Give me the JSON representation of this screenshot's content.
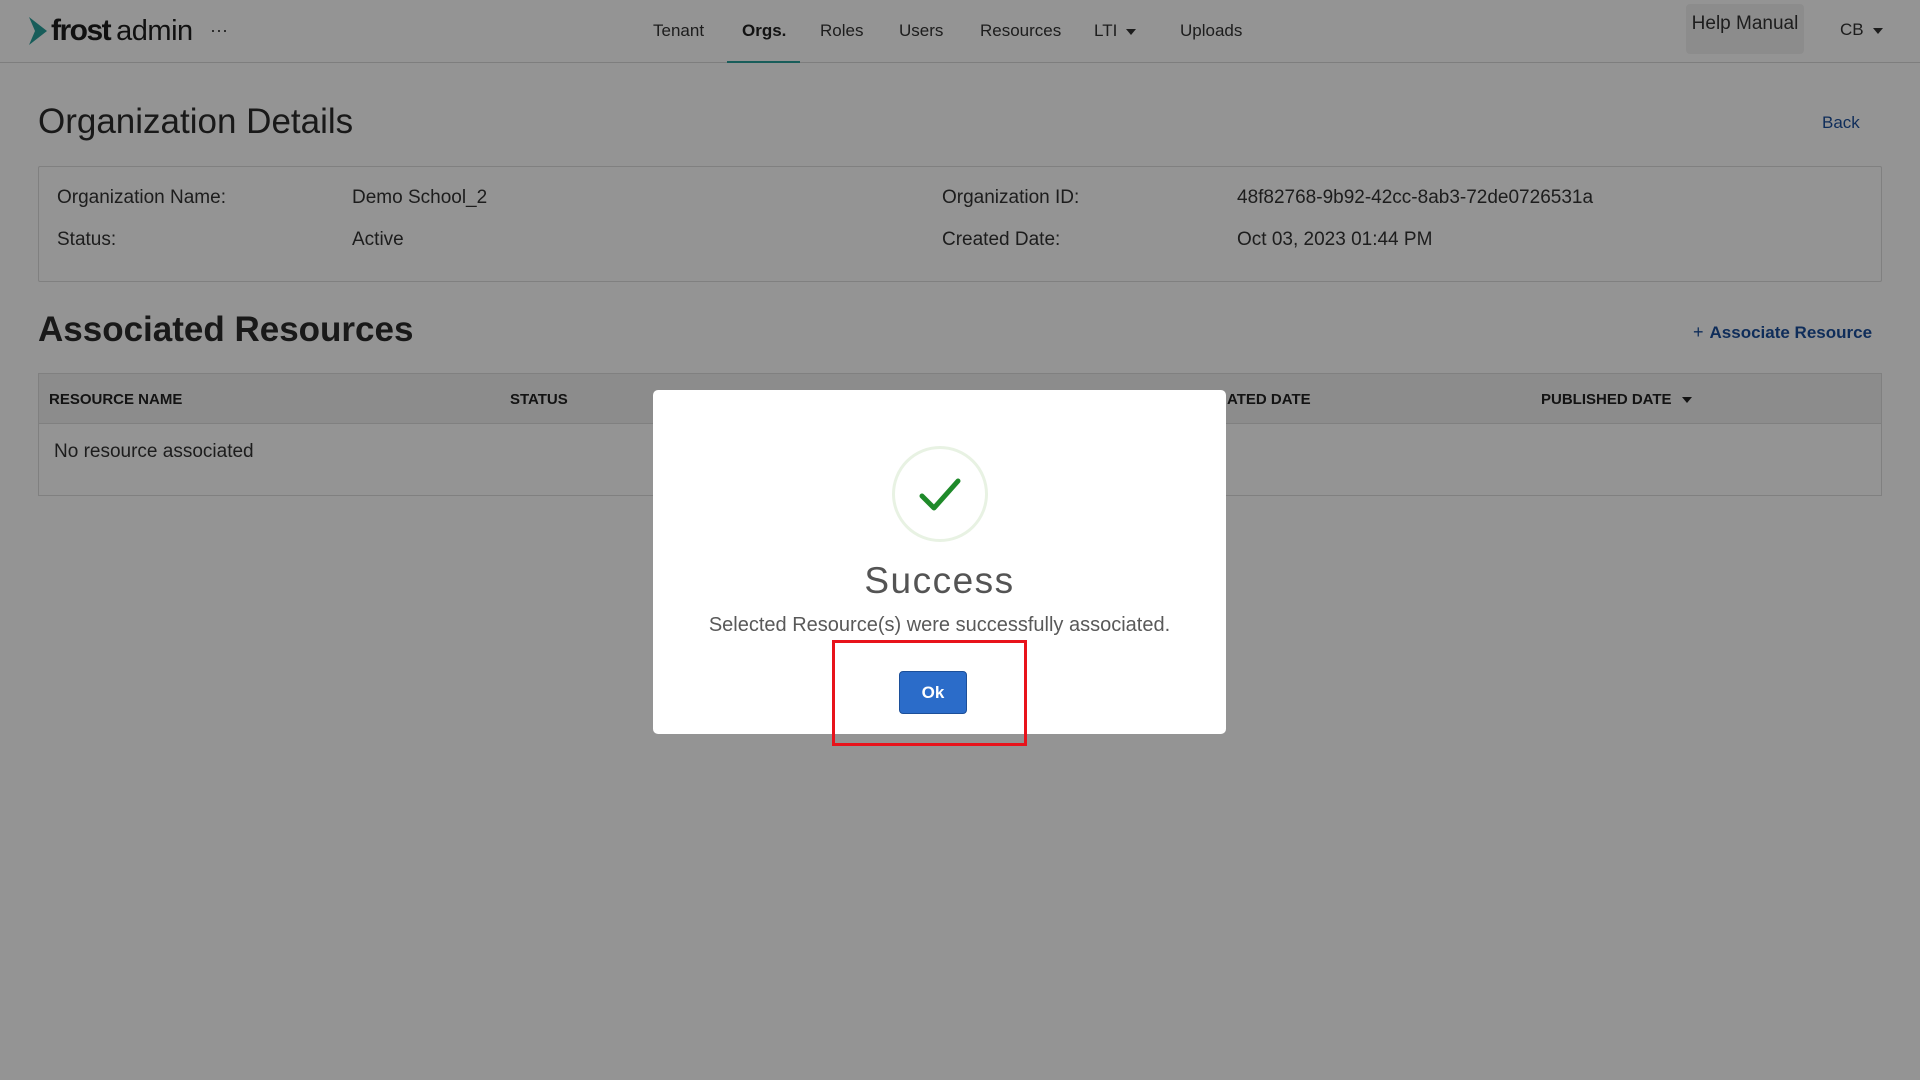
{
  "brand": {
    "frost": "frost",
    "admin": "admin",
    "mark_color": "#2aa19b"
  },
  "header": {
    "more_label": "···",
    "nav": [
      {
        "label": "Tenant"
      },
      {
        "label": "Orgs.",
        "active": true
      },
      {
        "label": "Roles"
      },
      {
        "label": "Users"
      },
      {
        "label": "Resources"
      },
      {
        "label": "LTI",
        "has_dropdown": true
      },
      {
        "label": "Uploads"
      }
    ],
    "help_label": "Help Manual",
    "user_label": "CB"
  },
  "page": {
    "title": "Organization Details",
    "back_label": "Back",
    "details": {
      "org_name_label": "Organization Name:",
      "org_name_value": "Demo School_2",
      "status_label": "Status:",
      "status_value": "Active",
      "org_id_label": "Organization ID:",
      "org_id_value": "48f82768-9b92-42cc-8ab3-72de0726531a",
      "created_label": "Created Date:",
      "created_value": "Oct 03, 2023 01:44 PM"
    }
  },
  "resources": {
    "title": "Associated Resources",
    "associate_label": "Associate Resource",
    "columns": [
      "RESOURCE NAME",
      "STATUS",
      "ATED DATE",
      "PUBLISHED DATE"
    ],
    "empty_text": "No resource associated"
  },
  "modal": {
    "icon": "check-icon",
    "title": "Success",
    "message": "Selected Resource(s) were successfully associated.",
    "ok_label": "Ok",
    "success_color": "#1f8a2a",
    "button_color": "#2b6cc9"
  },
  "annotation": {
    "highlight_color": "#e8131b"
  }
}
